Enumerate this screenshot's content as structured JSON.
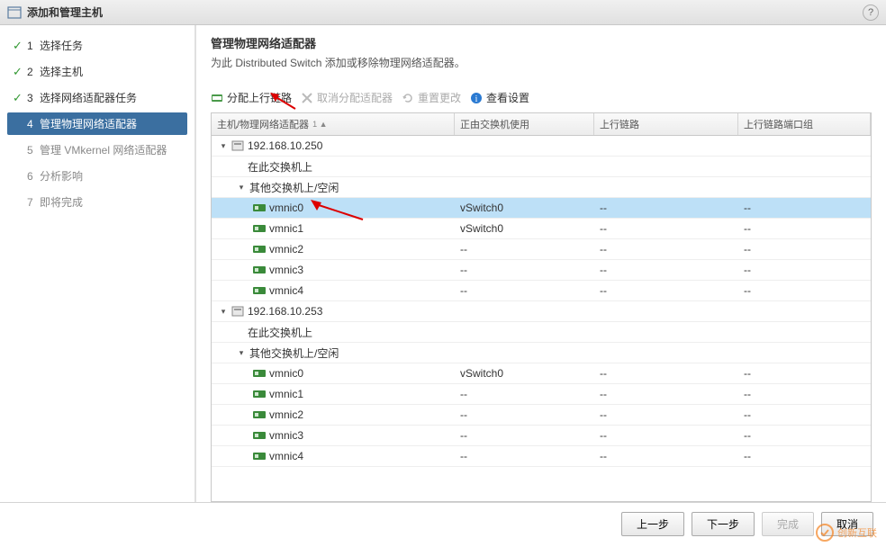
{
  "title": "添加和管理主机",
  "steps": [
    {
      "num": "1",
      "label": "选择任务",
      "state": "done"
    },
    {
      "num": "2",
      "label": "选择主机",
      "state": "done"
    },
    {
      "num": "3",
      "label": "选择网络适配器任务",
      "state": "done"
    },
    {
      "num": "4",
      "label": "管理物理网络适配器",
      "state": "active"
    },
    {
      "num": "5",
      "label": "管理 VMkernel 网络适配器",
      "state": "pending"
    },
    {
      "num": "6",
      "label": "分析影响",
      "state": "pending"
    },
    {
      "num": "7",
      "label": "即将完成",
      "state": "pending"
    }
  ],
  "heading": "管理物理网络适配器",
  "subheading": "为此 Distributed Switch 添加或移除物理网络适配器。",
  "toolbar": {
    "assign": "分配上行链路",
    "unassign": "取消分配适配器",
    "reset": "重置更改",
    "view": "查看设置"
  },
  "columns": {
    "c1": "主机/物理网络适配器",
    "c2": "正由交换机使用",
    "c3": "上行链路",
    "c4": "上行链路端口组"
  },
  "sortMarker": "1 ▲",
  "hostIp1": "192.168.10.250",
  "hostIp2": "192.168.10.253",
  "group1": "在此交换机上",
  "group2": "其他交换机上/空闲",
  "nics": [
    "vmnic0",
    "vmnic1",
    "vmnic2",
    "vmnic3",
    "vmnic4"
  ],
  "vswitch": "vSwitch0",
  "dash": "--",
  "buttons": {
    "back": "上一步",
    "next": "下一步",
    "finish": "完成",
    "cancel": "取消"
  },
  "watermark": "创新互联"
}
